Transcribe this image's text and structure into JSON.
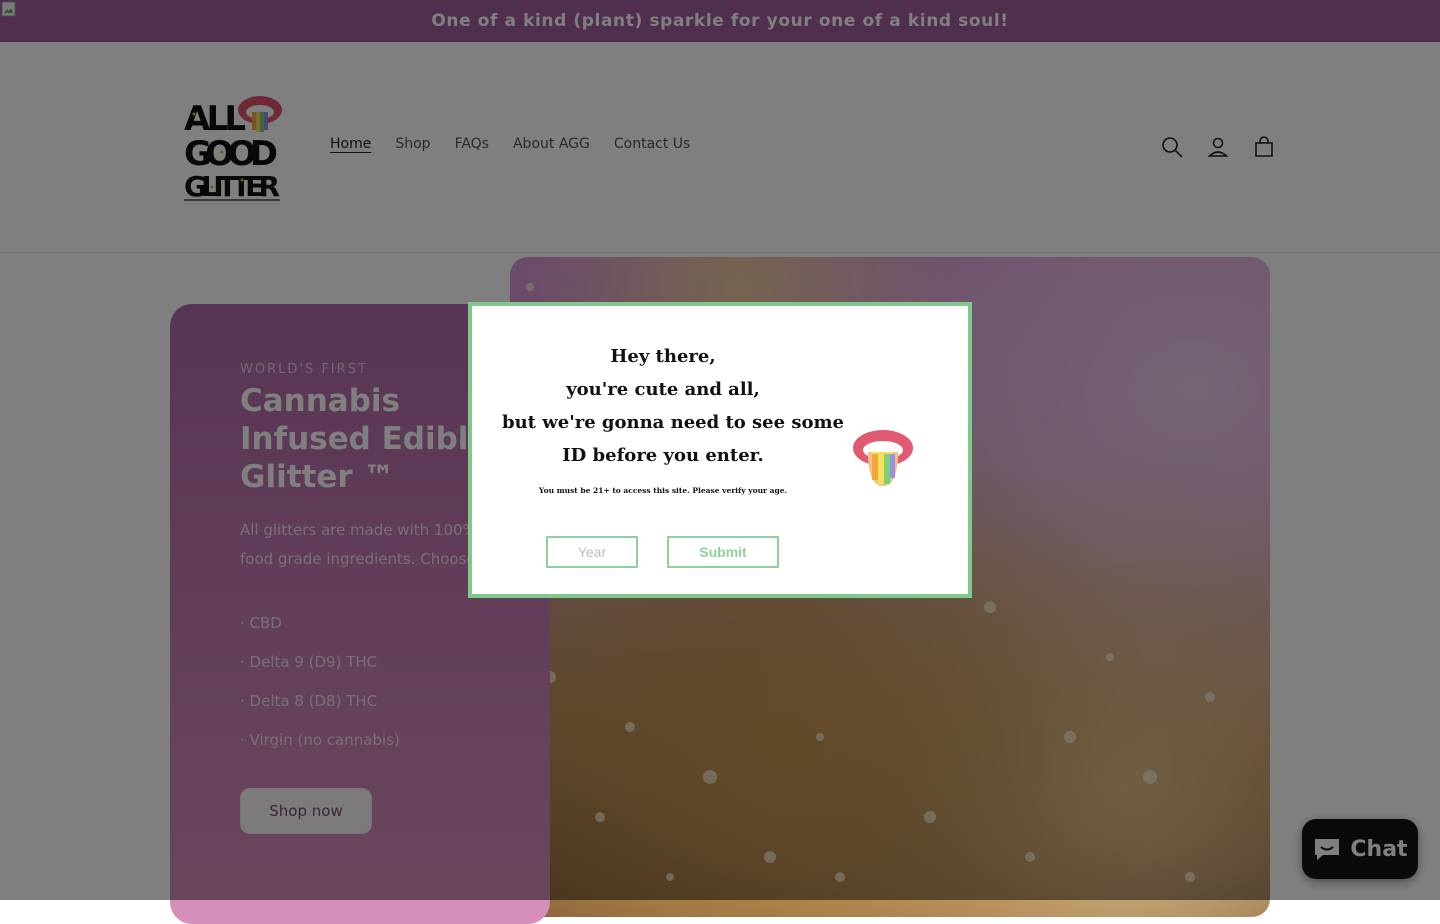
{
  "announcement": {
    "text": "One of a kind (plant) sparkle for your one of a kind soul!"
  },
  "header": {
    "logo": {
      "line1": "ALL",
      "line2": "GOOD",
      "line3": "GLITTER",
      "tagline": "World's First Cannabis Infused Edible Glitter"
    },
    "nav": [
      "Home",
      "Shop",
      "FAQs",
      "About AGG",
      "Contact Us"
    ],
    "icons": [
      "search-icon",
      "account-icon",
      "cart-icon"
    ]
  },
  "hero": {
    "kicker": "WORLD'S FIRST",
    "title": "Cannabis Infused Edible Glitter ™",
    "description": "All glitters are made with 100% edible, food grade ingredients. Choose from:",
    "options": [
      "· CBD",
      "· Delta 9 (D9) THC",
      "· Delta 8 (D8) THC",
      "· Virgin (no cannabis)"
    ],
    "cta": "Shop now"
  },
  "age_gate": {
    "heading_lines": [
      "Hey there,",
      "you're cute and all,",
      "but we're gonna need to see some",
      "ID before you enter."
    ],
    "note": "You must be 21+ to access this site. Please verify your age.",
    "year_placeholder": "Year",
    "submit": "Submit"
  },
  "chat": {
    "label": "Chat"
  },
  "colors": {
    "brand_purple": "#a15c9d",
    "modal_border": "#7fc98e",
    "chat_bg": "#151515"
  }
}
